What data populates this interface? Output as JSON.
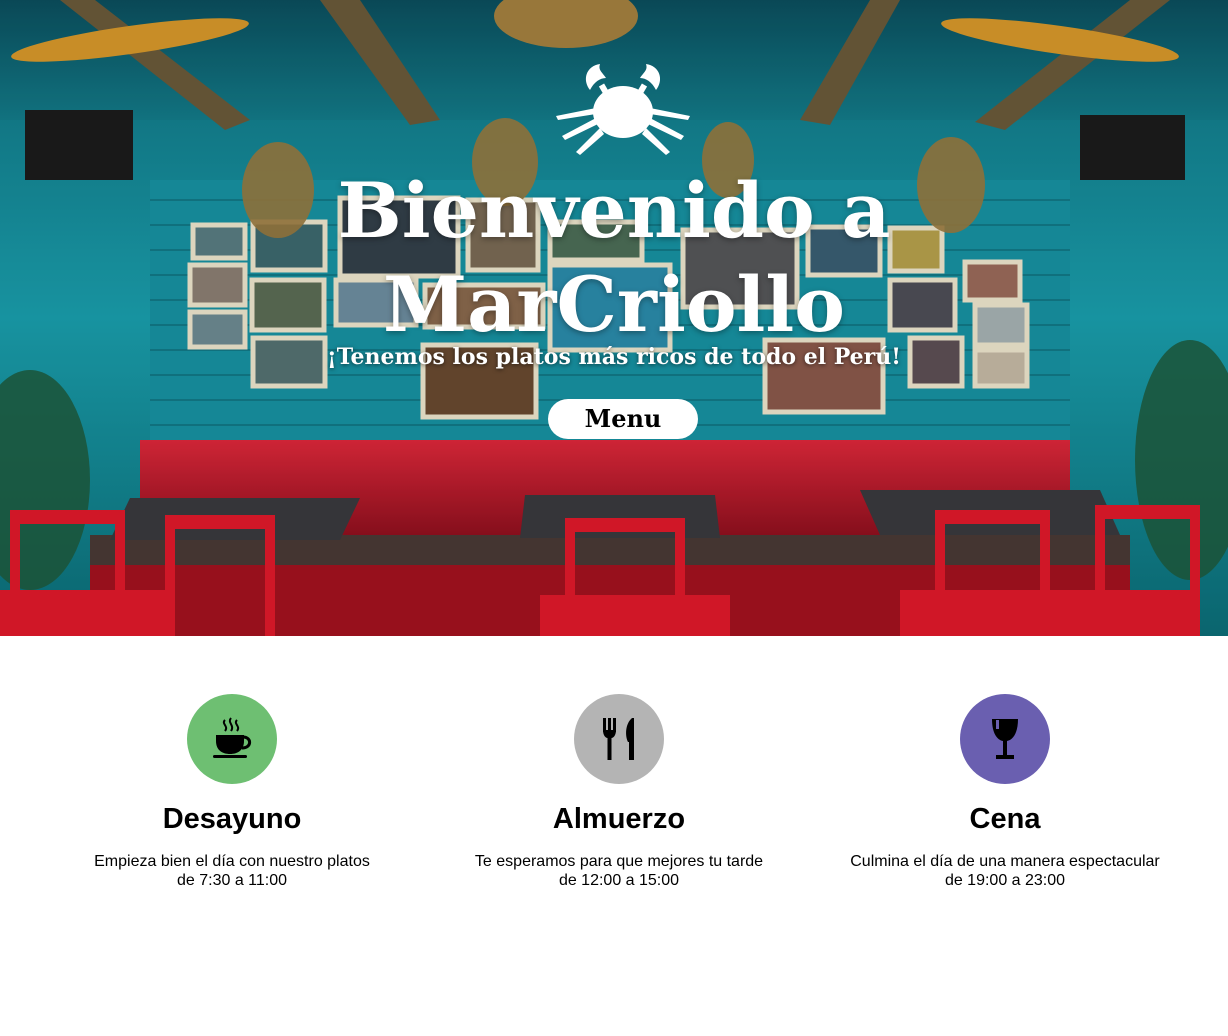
{
  "hero": {
    "title": "Bienvenido a MarCriollo",
    "subtitle": "¡Tenemos los platos más ricos de todo el Perú!",
    "menu_button_label": "Menu",
    "logo_icon": "crab-icon"
  },
  "services": [
    {
      "title": "Desayuno",
      "description": "Empieza bien el día con nuestro platos",
      "hours": "de 7:30 a 11:00",
      "icon": "coffee-cup-icon",
      "color": "#6ebf72"
    },
    {
      "title": "Almuerzo",
      "description": "Te esperamos para que mejores tu tarde",
      "hours": "de 12:00 a 15:00",
      "icon": "fork-knife-icon",
      "color": "#b4b4b4"
    },
    {
      "title": "Cena",
      "description": "Culmina el día de una manera espectacular",
      "hours": "de 19:00 a 23:00",
      "icon": "wine-glass-icon",
      "color": "#6a5fb0"
    }
  ]
}
